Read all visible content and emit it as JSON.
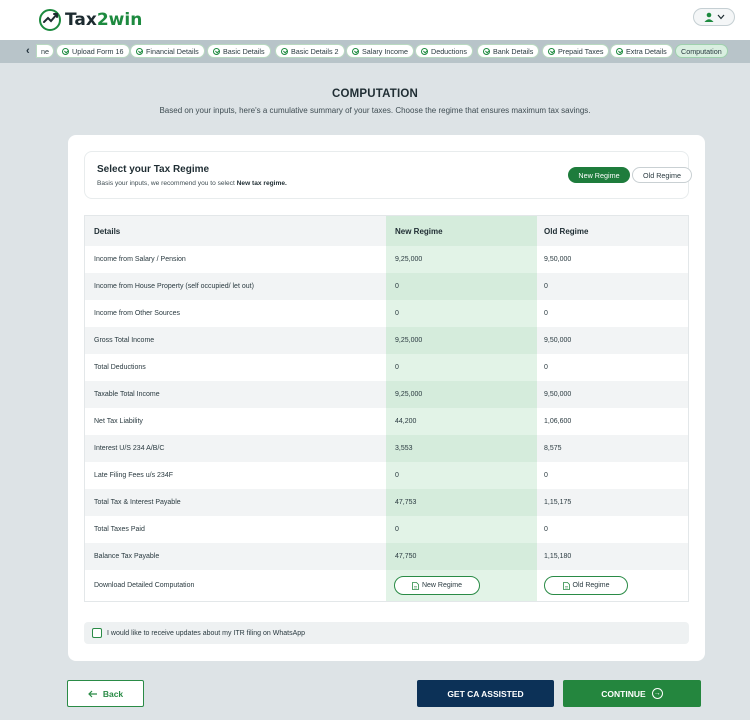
{
  "header": {
    "logo": {
      "text_main": "Tax",
      "text_accent": "2win"
    },
    "user_menu": {
      "icon": "user-icon",
      "caret_icon": "chevron-down-icon"
    }
  },
  "steps": [
    {
      "label": "ne",
      "done": false,
      "partial": true
    },
    {
      "label": "Upload Form 16",
      "done": true
    },
    {
      "label": "Financial Details",
      "done": true
    },
    {
      "label": "Basic Details",
      "done": true
    },
    {
      "label": "Basic Details 2",
      "done": true
    },
    {
      "label": "Salary Income",
      "done": true
    },
    {
      "label": "Deductions",
      "done": true
    },
    {
      "label": "Bank Details",
      "done": true
    },
    {
      "label": "Prepaid Taxes",
      "done": true
    },
    {
      "label": "Extra Details",
      "done": true
    },
    {
      "label": "Computation",
      "done": false,
      "active": true
    }
  ],
  "page": {
    "title": "COMPUTATION",
    "subtitle": "Based on your inputs, here's a cumulative summary of your taxes. Choose the regime that ensures maximum tax savings."
  },
  "regime": {
    "title": "Select your Tax Regime",
    "note_prefix": "Basis your inputs, we recommend you to select ",
    "note_bold": "New tax regime.",
    "options": {
      "new": "New Regime",
      "old": "Old Regime"
    },
    "selected": "new",
    "accent_color": "#1e7c3c"
  },
  "table": {
    "headers": {
      "details": "Details",
      "new": "New Regime",
      "old": "Old Regime"
    },
    "rows": [
      {
        "label": "Income from Salary / Pension",
        "new": "9,25,000",
        "old": "9,50,000"
      },
      {
        "label": "Income from House Property (self occupied/ let out)",
        "new": "0",
        "old": "0"
      },
      {
        "label": "Income from Other Sources",
        "new": "0",
        "old": "0"
      },
      {
        "label": "Gross Total Income",
        "new": "9,25,000",
        "old": "9,50,000"
      },
      {
        "label": "Total Deductions",
        "new": "0",
        "old": "0"
      },
      {
        "label": "Taxable Total Income",
        "new": "9,25,000",
        "old": "9,50,000"
      },
      {
        "label": "Net Tax Liability",
        "new": "44,200",
        "old": "1,06,600"
      },
      {
        "label": "Interest U/S 234 A/B/C",
        "new": "3,553",
        "old": "8,575"
      },
      {
        "label": "Late Filing Fees u/s 234F",
        "new": "0",
        "old": "0"
      },
      {
        "label": "Total Tax & Interest Payable",
        "new": "47,753",
        "old": "1,15,175"
      },
      {
        "label": "Total Taxes Paid",
        "new": "0",
        "old": "0"
      },
      {
        "label": "Balance Tax Payable",
        "new": "47,750",
        "old": "1,15,180"
      }
    ],
    "download": {
      "label": "Download Detailed Computation",
      "new_btn": "New Regime",
      "old_btn": "Old Regime"
    }
  },
  "whatsapp": {
    "label": "I would like to receive updates about my ITR filing on WhatsApp",
    "checked": false
  },
  "footer": {
    "back": "Back",
    "ca": "GET CA ASSISTED",
    "continue": "CONTINUE"
  }
}
